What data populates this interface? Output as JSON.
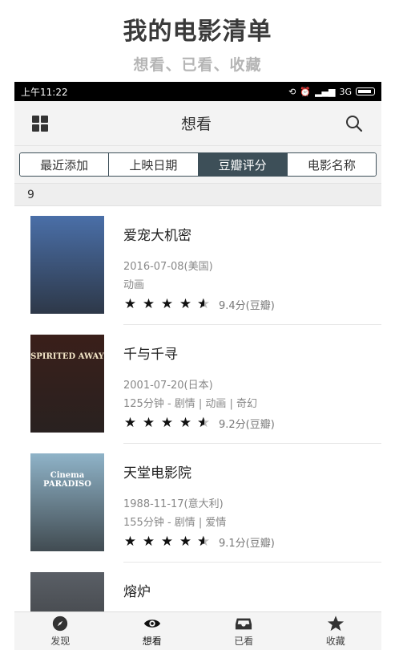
{
  "promo": {
    "title": "我的电影清单",
    "subtitle": "想看、已看、收藏"
  },
  "status_bar": {
    "time": "上午11:22",
    "network": "3G"
  },
  "app_bar": {
    "title": "想看",
    "left_icon": "grid-icon",
    "right_icon": "search-icon"
  },
  "sort_tabs": [
    {
      "label": "最近添加",
      "active": false
    },
    {
      "label": "上映日期",
      "active": false
    },
    {
      "label": "豆瓣评分",
      "active": true
    },
    {
      "label": "电影名称",
      "active": false
    }
  ],
  "count": "9",
  "movies": [
    {
      "title": "爱宠大机密",
      "date": "2016-07-08(美国)",
      "meta": "动画",
      "stars": 4.5,
      "rating": "9.4分(豆瓣)",
      "poster_color": "#4a6fa8"
    },
    {
      "title": "千与千寻",
      "date": "2001-07-20(日本)",
      "meta": "125分钟 - 剧情 | 动画 | 奇幻",
      "stars": 4.5,
      "rating": "9.2分(豆瓣)",
      "poster_text": "SPIRITED AWAY",
      "poster_color": "#3a1f1a"
    },
    {
      "title": "天堂电影院",
      "date": "1988-11-17(意大利)",
      "meta": "155分钟 - 剧情 | 爱情",
      "stars": 4.5,
      "rating": "9.1分(豆瓣)",
      "poster_text": "Cinema PARADISO",
      "poster_color": "#8fb3c8"
    },
    {
      "title": "熔炉",
      "date": "",
      "meta": "",
      "stars": 0,
      "rating": "",
      "poster_color": "#5a5f66"
    }
  ],
  "tab_bar": [
    {
      "label": "发现",
      "icon": "compass-icon",
      "active": false
    },
    {
      "label": "想看",
      "icon": "eye-icon",
      "active": true
    },
    {
      "label": "已看",
      "icon": "inbox-icon",
      "active": false
    },
    {
      "label": "收藏",
      "icon": "star-icon",
      "active": false
    }
  ]
}
